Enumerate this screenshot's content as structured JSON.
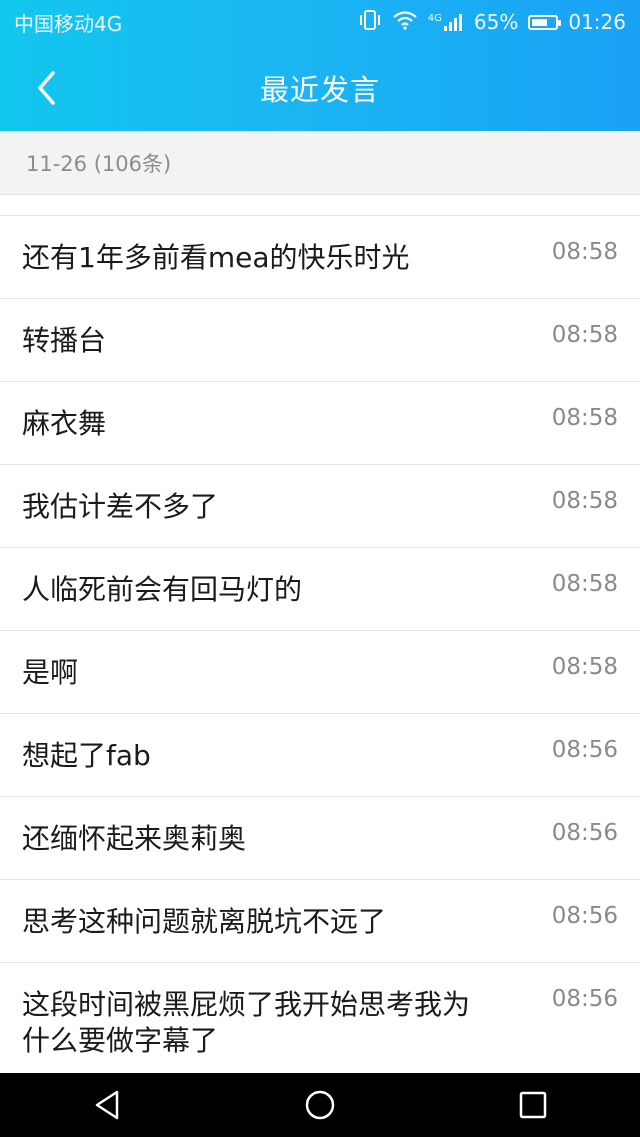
{
  "status_bar": {
    "carrier": "中国移动4G",
    "network": "4G",
    "battery": "65%",
    "battery_level": 0.65,
    "time": "01:26"
  },
  "header": {
    "title": "最近发言"
  },
  "date_bar": {
    "label": "11-26 (106条)"
  },
  "messages": [
    {
      "text": "还有1年多前看mea的快乐时光",
      "time": "08:58"
    },
    {
      "text": "转播台",
      "time": "08:58"
    },
    {
      "text": "麻衣舞",
      "time": "08:58"
    },
    {
      "text": "我估计差不多了",
      "time": "08:58"
    },
    {
      "text": "人临死前会有回马灯的",
      "time": "08:58"
    },
    {
      "text": "是啊",
      "time": "08:58"
    },
    {
      "text": "想起了fab",
      "time": "08:56"
    },
    {
      "text": "还缅怀起来奥莉奥",
      "time": "08:56"
    },
    {
      "text": "思考这种问题就离脱坑不远了",
      "time": "08:56"
    },
    {
      "text": "这段时间被黑屁烦了我开始思考我为什么要做字幕了",
      "time": "08:56"
    }
  ],
  "colors": {
    "header_start": "#12c7ee",
    "header_end": "#1aa2f6",
    "date_bar_bg": "#f3f3f3",
    "time_text": "#8a8a8a"
  },
  "icons": {
    "back": "chevron-left-icon",
    "nav_back": "triangle-back-icon",
    "nav_home": "circle-home-icon",
    "nav_recent": "square-recent-icon"
  }
}
